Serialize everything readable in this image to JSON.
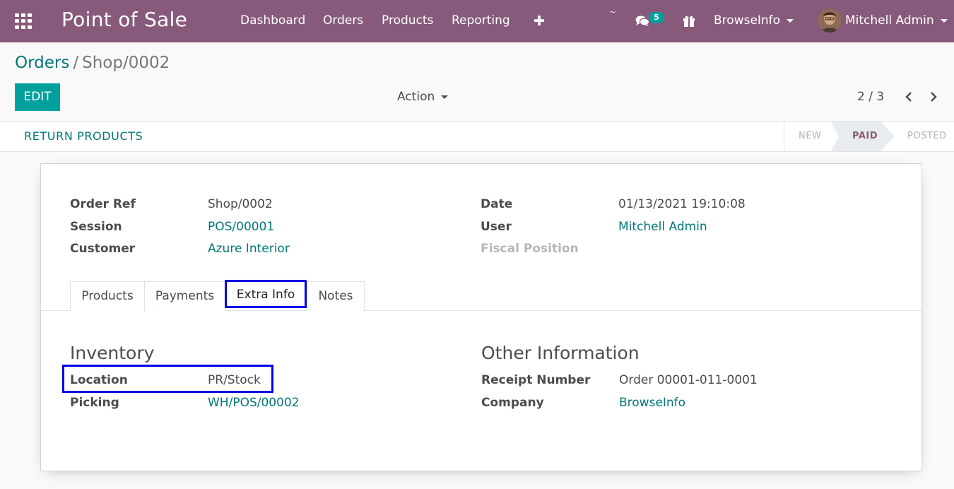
{
  "navbar": {
    "brand": "Point of Sale",
    "menu": [
      "Dashboard",
      "Orders",
      "Products",
      "Reporting"
    ],
    "tilde": "~",
    "chat_count": "5",
    "company": "BrowseInfo",
    "user": "Mitchell Admin",
    "bg_color": "#875a7b"
  },
  "breadcrumb": {
    "parent": "Orders",
    "separator": "/",
    "current": "Shop/0002"
  },
  "controls": {
    "edit_label": "EDIT",
    "action_label": "Action",
    "pager": "2 / 3"
  },
  "statusbar": {
    "return_label": "RETURN PRODUCTS",
    "stages": [
      "NEW",
      "PAID",
      "POSTED"
    ],
    "active_stage": "PAID"
  },
  "form": {
    "order_ref_label": "Order Ref",
    "order_ref": "Shop/0002",
    "session_label": "Session",
    "session": "POS/00001",
    "customer_label": "Customer",
    "customer": "Azure Interior",
    "date_label": "Date",
    "date": "01/13/2021 19:10:08",
    "user_label": "User",
    "user": "Mitchell Admin",
    "fiscal_label": "Fiscal Position"
  },
  "tabs": [
    "Products",
    "Payments",
    "Extra Info",
    "Notes"
  ],
  "active_tab": "Extra Info",
  "extra_info": {
    "inventory_title": "Inventory",
    "location_label": "Location",
    "location": "PR/Stock",
    "picking_label": "Picking",
    "picking": "WH/POS/00002",
    "other_title": "Other Information",
    "receipt_label": "Receipt Number",
    "receipt": "Order 00001-011-0001",
    "company_label": "Company",
    "company": "BrowseInfo"
  },
  "colors": {
    "accent": "#00a09d",
    "link": "#00777a",
    "highlight": "#0000e0"
  }
}
